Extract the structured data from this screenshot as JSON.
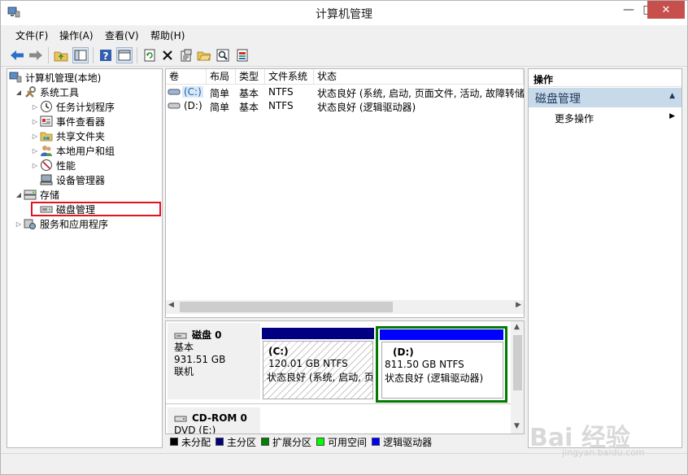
{
  "window": {
    "title": "计算机管理",
    "controls": {
      "minimize": "—",
      "maximize": "□",
      "close": "✕"
    }
  },
  "menu": [
    "文件(F)",
    "操作(A)",
    "查看(V)",
    "帮助(H)"
  ],
  "toolbar_icons": [
    "back-arrow-icon",
    "forward-arrow-icon",
    "up-folder-icon",
    "show-hide-tree-icon",
    "help-icon",
    "show-hide-action-icon",
    "refresh-icon",
    "delete-icon",
    "properties-icon",
    "open-folder-icon",
    "search-icon",
    "export-icon"
  ],
  "tree": {
    "root": "计算机管理(本地)",
    "items": [
      {
        "label": "系统工具",
        "level": 1
      },
      {
        "label": "任务计划程序",
        "level": 2
      },
      {
        "label": "事件查看器",
        "level": 2
      },
      {
        "label": "共享文件夹",
        "level": 2
      },
      {
        "label": "本地用户和组",
        "level": 2
      },
      {
        "label": "性能",
        "level": 2
      },
      {
        "label": "设备管理器",
        "level": 2
      },
      {
        "label": "存储",
        "level": 1
      },
      {
        "label": "磁盘管理",
        "level": 2
      },
      {
        "label": "服务和应用程序",
        "level": 1
      }
    ]
  },
  "volume_table": {
    "headers": [
      "卷",
      "布局",
      "类型",
      "文件系统",
      "状态"
    ],
    "rows": [
      {
        "vol": "(C:)",
        "layout": "简单",
        "type": "基本",
        "fs": "NTFS",
        "status": "状态良好 (系统, 启动, 页面文件, 活动, 故障转储,"
      },
      {
        "vol": "(D:)",
        "layout": "简单",
        "type": "基本",
        "fs": "NTFS",
        "status": "状态良好 (逻辑驱动器)"
      }
    ]
  },
  "disks": [
    {
      "name": "磁盘 0",
      "kind": "基本",
      "size": "931.51 GB",
      "state": "联机"
    },
    {
      "name": "CD-ROM 0",
      "kind": "DVD (E:)"
    }
  ],
  "partitions": [
    {
      "label": "(C:)",
      "size": "120.01 GB NTFS",
      "status": "状态良好 (系统, 启动, 页"
    },
    {
      "label": "(D:)",
      "size": "811.50 GB NTFS",
      "status": "状态良好 (逻辑驱动器)"
    }
  ],
  "legend": [
    {
      "label": "未分配",
      "color": "#000000"
    },
    {
      "label": "主分区",
      "color": "#000080"
    },
    {
      "label": "扩展分区",
      "color": "#008000"
    },
    {
      "label": "可用空间",
      "color": "#00ff00"
    },
    {
      "label": "逻辑驱动器",
      "color": "#0000ff"
    }
  ],
  "actions": {
    "title": "操作",
    "section": "磁盘管理",
    "items": [
      "更多操作"
    ]
  },
  "watermark": {
    "main": "Bai 经验",
    "sub": "jingyan.baidu.com"
  }
}
